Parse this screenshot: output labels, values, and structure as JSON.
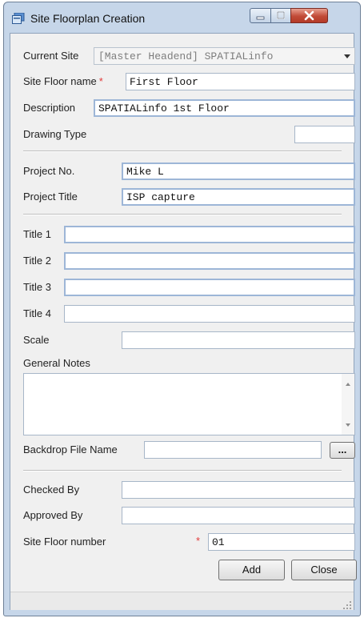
{
  "window": {
    "title": "Site Floorplan Creation"
  },
  "form": {
    "current_site_label": "Current Site",
    "current_site_value": "[Master Headend] SPATIALinfo",
    "site_floor_name_label": "Site Floor name",
    "required_marker": "*",
    "site_floor_name_value": "First Floor",
    "description_label": "Description",
    "description_value": "SPATIALinfo 1st Floor",
    "drawing_type_label": "Drawing Type",
    "drawing_type_value": "",
    "project_no_label": "Project No.",
    "project_no_value": "Mike L",
    "project_title_label": "Project Title",
    "project_title_value": "ISP capture",
    "title1_label": "Title 1",
    "title1_value": "",
    "title2_label": "Title 2",
    "title2_value": "",
    "title3_label": "Title 3",
    "title3_value": "",
    "title4_label": "Title 4",
    "title4_value": "",
    "scale_label": "Scale",
    "scale_value": "",
    "general_notes_label": "General Notes",
    "general_notes_value": "",
    "backdrop_label": "Backdrop File Name",
    "backdrop_value": "",
    "browse_label": "...",
    "checked_by_label": "Checked By",
    "checked_by_value": "",
    "approved_by_label": "Approved By",
    "approved_by_value": "",
    "site_floor_number_label": "Site Floor number",
    "site_floor_number_value": "01"
  },
  "buttons": {
    "add": "Add",
    "close": "Close"
  },
  "colors": {
    "title_bar": "#c6d6e9",
    "close_button": "#c14a37",
    "required": "#e23b3b",
    "window_bg": "#f0f0f0"
  },
  "icons": {
    "app": "app-window-icon",
    "minimize": "minimize-icon",
    "maximize": "maximize-icon",
    "close": "close-icon",
    "scroll_up": "scroll-up-icon",
    "scroll_down": "scroll-down-icon",
    "resize": "resize-grip-icon"
  }
}
